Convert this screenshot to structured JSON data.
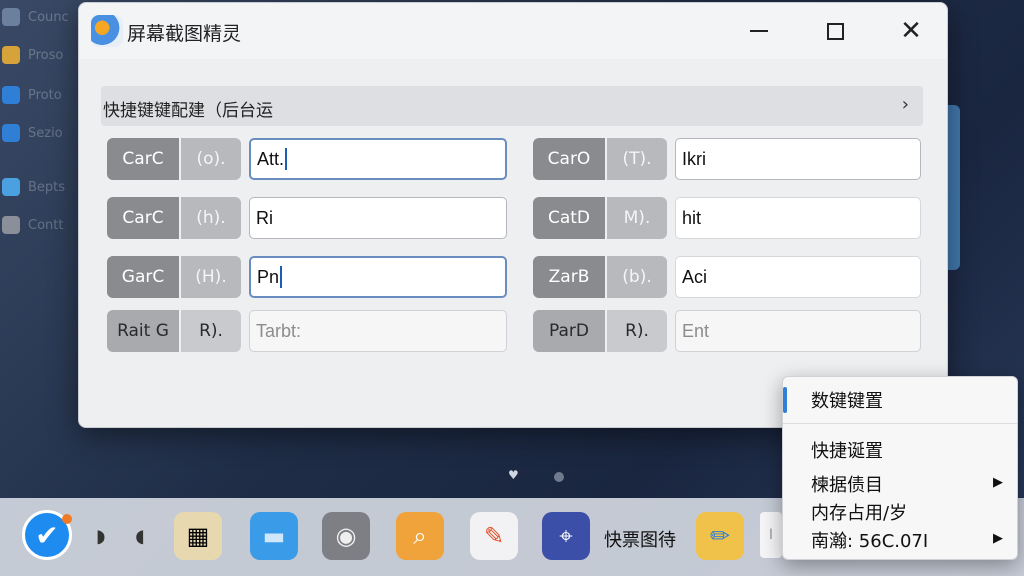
{
  "background": {
    "sidebar_items": [
      {
        "label": "Counc",
        "color": "#6b7f9e"
      },
      {
        "label": "Proso",
        "color": "#d6a23a"
      },
      {
        "label": "Proto",
        "color": "#2f7fd6"
      },
      {
        "label": "Sezio",
        "color": "#2f7fd6"
      },
      {
        "label": "Bepts",
        "color": "#4aa0e0"
      },
      {
        "label": "Contt",
        "color": "#8a8f99"
      }
    ]
  },
  "window": {
    "title": "屏幕截图精灵",
    "controls": {
      "minimize": "—",
      "maximize": "☐",
      "close": "✕"
    },
    "section": {
      "title": "快捷键键配建（后台运",
      "chevron": "›"
    },
    "left_rows": [
      {
        "key_a": "CarC",
        "key_b": "(o).",
        "value": "Att.",
        "focused": true,
        "caret": true
      },
      {
        "key_a": "CarC",
        "key_b": "(h).",
        "value": "Ri",
        "focused": false,
        "caret": false
      },
      {
        "key_a": "GarC",
        "key_b": "(H).",
        "value": "Pn",
        "focused": true,
        "caret": true
      },
      {
        "key_a": "Rait G",
        "key_b": "R).",
        "value": "Tarbt:",
        "muted": true,
        "dark": true
      }
    ],
    "right_rows": [
      {
        "key_a": "CarO",
        "key_b": "(T).",
        "value": "Ikri"
      },
      {
        "key_a": "CatD",
        "key_b": "M).",
        "value": "hit"
      },
      {
        "key_a": "ZarB",
        "key_b": "(b).",
        "value": "Aci"
      },
      {
        "key_a": "ParD",
        "key_b": "R).",
        "value": "Ent",
        "muted": true,
        "dark": true
      }
    ]
  },
  "pager": {
    "active": "♥",
    "inactive": "•"
  },
  "dock": {
    "items": [
      {
        "name": "start-icon",
        "glyph": "✔"
      },
      {
        "name": "nav-arrows",
        "glyph": "◗ ◖"
      },
      {
        "name": "apps-icon",
        "glyph": "▦",
        "bg": "#e8d8b0"
      },
      {
        "name": "folder-icon",
        "glyph": "▬",
        "bg": "#3a9be8"
      },
      {
        "name": "panda-icon",
        "glyph": "◉",
        "bg": "#7d7f85"
      },
      {
        "name": "magnifier-icon",
        "glyph": "⌕",
        "bg": "#f0a33a"
      },
      {
        "name": "chat-icon",
        "glyph": "✎",
        "bg": "#f2f2f4"
      },
      {
        "name": "maps-pin-icon",
        "glyph": "⌖",
        "bg": "#3b4fa8"
      },
      {
        "name": "pen-icon",
        "glyph": "✏",
        "bg": "#f0c24a"
      }
    ],
    "label": "快票图待",
    "partial_tail": "Ⅰ"
  },
  "menu": {
    "items": [
      {
        "label": "数键键置",
        "arrow": ""
      },
      {
        "label": "快捷诞置",
        "arrow": ""
      },
      {
        "label": "楝据债目",
        "arrow": "▶"
      },
      {
        "label": "内存占用/岁",
        "arrow": ""
      },
      {
        "label": "南瀚: 56C.07I",
        "arrow": "▶"
      }
    ],
    "accent": "#2f7fd6"
  }
}
